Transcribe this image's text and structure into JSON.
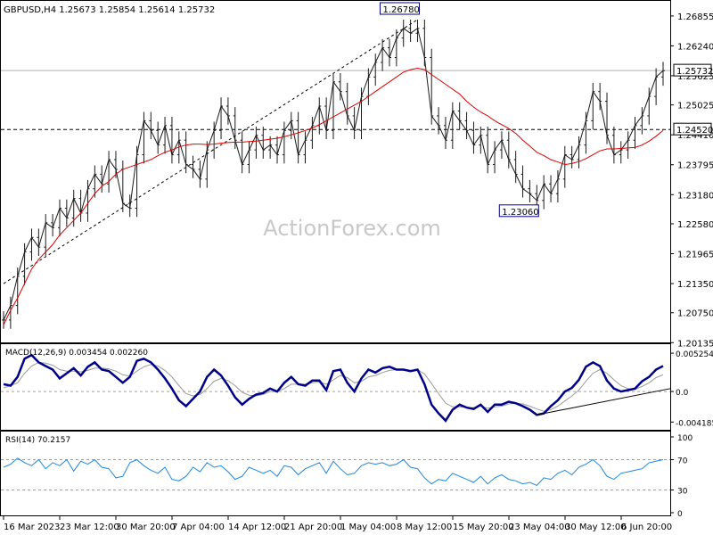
{
  "chart_data": {
    "type": "line",
    "title": "GBPUSD,H4  1.25673  1.25854  1.25614  1.25732",
    "watermark": "ActionForex.com",
    "colors": {
      "price": "#1a1a1a",
      "ma": "#e00000",
      "macd": "#00008b",
      "signal": "#9a9a9a",
      "rsi": "#1e88e5",
      "grid": "#a0a0a0"
    },
    "x_labels": [
      "16 Mar 2023",
      "23 Mar 12:00",
      "30 Mar 20:00",
      "7 Apr 04:00",
      "14 Apr 12:00",
      "21 Apr 20:00",
      "1 May 04:00",
      "8 May 12:00",
      "15 May 20:00",
      "23 May 04:00",
      "30 May 12:00",
      "6 Jun 20:00"
    ],
    "price_panel": {
      "y_ticks": [
        "1.26855",
        "1.26240",
        "1.25625",
        "1.25025",
        "1.24410",
        "1.23795",
        "1.23180",
        "1.22580",
        "1.21965",
        "1.21350",
        "1.20750",
        "1.20135"
      ],
      "ylim": [
        1.2014,
        1.27
      ],
      "current_price": 1.25732,
      "current_price_label": "1.25732",
      "support_level": 1.2452,
      "support_label": "1.24520",
      "annotations": [
        {
          "text": "1.26780",
          "value": 1.2678
        },
        {
          "text": "1.23060",
          "value": 1.2306
        }
      ],
      "trendline": [
        {
          "date_index": 0,
          "value": 1.2135
        },
        {
          "date_index": 59,
          "value": 1.2678
        }
      ],
      "close": [
        1.206,
        1.209,
        1.215,
        1.22,
        1.223,
        1.221,
        1.226,
        1.225,
        1.229,
        1.227,
        1.231,
        1.228,
        1.233,
        1.236,
        1.234,
        1.239,
        1.237,
        1.23,
        1.229,
        1.24,
        1.247,
        1.245,
        1.242,
        1.246,
        1.24,
        1.243,
        1.238,
        1.237,
        1.235,
        1.241,
        1.245,
        1.25,
        1.248,
        1.243,
        1.238,
        1.241,
        1.244,
        1.241,
        1.242,
        1.24,
        1.245,
        1.247,
        1.24,
        1.243,
        1.246,
        1.25,
        1.245,
        1.255,
        1.253,
        1.248,
        1.245,
        1.252,
        1.256,
        1.259,
        1.262,
        1.26,
        1.264,
        1.266,
        1.265,
        1.266,
        1.26,
        1.248,
        1.246,
        1.243,
        1.249,
        1.247,
        1.245,
        1.242,
        1.244,
        1.238,
        1.241,
        1.243,
        1.239,
        1.236,
        1.233,
        1.232,
        1.2306,
        1.234,
        1.232,
        1.235,
        1.24,
        1.239,
        1.242,
        1.247,
        1.253,
        1.251,
        1.244,
        1.24,
        1.241,
        1.243,
        1.246,
        1.248,
        1.252,
        1.256,
        1.2573
      ],
      "ma": [
        1.205,
        1.208,
        1.2105,
        1.2135,
        1.2165,
        1.2185,
        1.22,
        1.2215,
        1.2235,
        1.225,
        1.2265,
        1.228,
        1.23,
        1.232,
        1.2335,
        1.2345,
        1.236,
        1.237,
        1.2375,
        1.238,
        1.2385,
        1.239,
        1.2398,
        1.2405,
        1.241,
        1.2416,
        1.242,
        1.2422,
        1.2422,
        1.2421,
        1.2422,
        1.2424,
        1.2425,
        1.2426,
        1.2426,
        1.2427,
        1.2428,
        1.243,
        1.2432,
        1.2434,
        1.2437,
        1.2441,
        1.2445,
        1.245,
        1.2455,
        1.2462,
        1.247,
        1.2478,
        1.2486,
        1.2494,
        1.2502,
        1.251,
        1.252,
        1.253,
        1.254,
        1.255,
        1.256,
        1.257,
        1.2575,
        1.2578,
        1.2575,
        1.2565,
        1.2555,
        1.2545,
        1.2535,
        1.2525,
        1.251,
        1.2498,
        1.2488,
        1.248,
        1.247,
        1.2462,
        1.2454,
        1.2444,
        1.243,
        1.2418,
        1.2405,
        1.2398,
        1.239,
        1.2385,
        1.238,
        1.2382,
        1.2386,
        1.2392,
        1.24,
        1.2408,
        1.2412,
        1.2412,
        1.2413,
        1.2414,
        1.2415,
        1.242,
        1.2428,
        1.2438,
        1.245
      ]
    },
    "macd_panel": {
      "label": "MACD(12,26,9) 0.003454 0.002260",
      "y_ticks": [
        "0.005254",
        "0.0",
        "-0.004185"
      ],
      "ylim": [
        -0.005,
        0.006
      ],
      "macd": [
        0.001,
        0.0008,
        0.002,
        0.0045,
        0.005,
        0.004,
        0.0035,
        0.003,
        0.0018,
        0.0025,
        0.0032,
        0.0022,
        0.0034,
        0.004,
        0.003,
        0.0028,
        0.002,
        0.0012,
        0.002,
        0.0042,
        0.0045,
        0.004,
        0.003,
        0.0018,
        0.0004,
        -0.0012,
        -0.002,
        -0.001,
        0.0,
        0.002,
        0.003,
        0.0022,
        0.0008,
        -0.0008,
        -0.0018,
        -0.001,
        -0.0004,
        -0.0002,
        0.0004,
        0.0,
        0.0012,
        0.002,
        0.001,
        0.0008,
        0.0015,
        0.0015,
        0.0002,
        0.0028,
        0.003,
        0.0012,
        0.0,
        0.0018,
        0.003,
        0.0026,
        0.0032,
        0.0034,
        0.003,
        0.003,
        0.0028,
        0.003,
        0.001,
        -0.0018,
        -0.003,
        -0.004,
        -0.0025,
        -0.0018,
        -0.0022,
        -0.0024,
        -0.0018,
        -0.0028,
        -0.0018,
        -0.0018,
        -0.0014,
        -0.0016,
        -0.002,
        -0.0025,
        -0.0032,
        -0.003,
        -0.002,
        -0.0012,
        0.0,
        0.0005,
        0.0016,
        0.0034,
        0.004,
        0.0035,
        0.0015,
        0.0004,
        0.0,
        0.0002,
        0.0004,
        0.0014,
        0.002,
        0.003,
        0.0035
      ],
      "signal": [
        0.0005,
        0.0008,
        0.0012,
        0.0025,
        0.0035,
        0.004,
        0.0039,
        0.0036,
        0.003,
        0.0028,
        0.0028,
        0.0027,
        0.0029,
        0.0032,
        0.0032,
        0.0031,
        0.0028,
        0.0023,
        0.0021,
        0.0028,
        0.0034,
        0.0037,
        0.0035,
        0.0029,
        0.002,
        0.0008,
        -0.0003,
        -0.0006,
        -0.0004,
        0.0004,
        0.0014,
        0.0018,
        0.0015,
        0.0008,
        -0.0001,
        -0.0005,
        -0.0006,
        -0.0004,
        0.0,
        0.0,
        0.0004,
        0.001,
        0.001,
        0.001,
        0.0012,
        0.0013,
        0.001,
        0.0016,
        0.0022,
        0.0019,
        0.0012,
        0.0014,
        0.002,
        0.0022,
        0.0026,
        0.0029,
        0.003,
        0.003,
        0.0029,
        0.003,
        0.0024,
        0.0011,
        -0.0003,
        -0.0016,
        -0.0021,
        -0.0021,
        -0.0022,
        -0.0022,
        -0.002,
        -0.0023,
        -0.0021,
        -0.002,
        -0.0017,
        -0.0016,
        -0.0017,
        -0.002,
        -0.0024,
        -0.0027,
        -0.0025,
        -0.002,
        -0.0013,
        -0.0006,
        0.0002,
        0.0014,
        0.0025,
        0.003,
        0.0025,
        0.0016,
        0.0008,
        0.0004,
        0.0003,
        0.0007,
        0.0012,
        0.0019,
        0.0023
      ]
    },
    "rsi_panel": {
      "label": "RSI(14) 70.2157",
      "y_ticks": [
        "100",
        "70",
        "30",
        "0"
      ],
      "ylim": [
        0,
        100
      ],
      "values": [
        60,
        64,
        72,
        66,
        62,
        70,
        58,
        66,
        62,
        70,
        55,
        68,
        64,
        70,
        60,
        58,
        46,
        48,
        66,
        70,
        62,
        56,
        52,
        60,
        44,
        42,
        48,
        60,
        54,
        66,
        60,
        62,
        54,
        44,
        48,
        60,
        56,
        52,
        56,
        48,
        62,
        60,
        50,
        58,
        62,
        66,
        52,
        68,
        58,
        50,
        52,
        62,
        66,
        64,
        66,
        62,
        64,
        70,
        60,
        58,
        46,
        38,
        44,
        42,
        52,
        48,
        44,
        40,
        48,
        38,
        46,
        50,
        44,
        42,
        38,
        40,
        36,
        46,
        44,
        52,
        56,
        50,
        60,
        64,
        70,
        62,
        48,
        44,
        52,
        54,
        56,
        58,
        66,
        68,
        70
      ]
    }
  }
}
